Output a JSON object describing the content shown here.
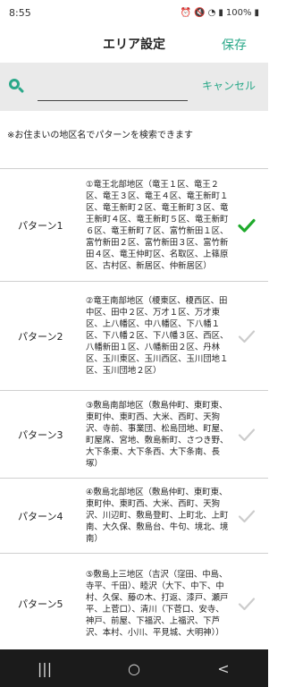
{
  "status_bar": {
    "time": "8:55",
    "battery": "100%"
  },
  "header": {
    "title": "エリア設定",
    "save_label": "保存"
  },
  "search": {
    "value": "",
    "placeholder": "",
    "cancel_label": "キャンセル"
  },
  "hint": "※お住まいの地区名でパターンを検索できます",
  "patterns": [
    {
      "name": "パターン1",
      "description": "①竜王北部地区（竜王１区、竜王２区、竜王３区、竜王４区、竜王新町１区、竜王新町２区、竜王新町３区、竜王新町４区、竜王新町５区、竜王新町６区、竜王新町７区、富竹新田１区、富竹新田２区、富竹新田３区、富竹新田４区、竜王仲町区、名取区、上篠原区、古村区、新居区、仲新居区）",
      "selected": true
    },
    {
      "name": "パターン2",
      "description": "②竜王南部地区（榎東区、榎西区、田中区、田中２区、万才１区、万才東区、上八幡区、中八幡区、下八幡１区、下八幡２区、下八幡３区、西区、八幡新田１区、八幡新田２区、丹林区、玉川東区、玉川西区、玉川団地１区、玉川団地２区）",
      "selected": false
    },
    {
      "name": "パターン3",
      "description": "③敷島南部地区（敷島仲町、東町東、東町仲、東町西、大米、西町、天狗沢、寺前、事業団、松島団地、町屋、町屋席、宮地、敷島新町、さつき野、大下条東、大下条西、大下条南、長塚）",
      "selected": false
    },
    {
      "name": "パターン4",
      "description": "④敷島北部地区（敷島仲町、東町東、東町仲、東町西、大米、西町、天狗沢、川辺町、敷島登町、上町北、上町南、大久保、敷島台、牛句、境北、境南）",
      "selected": false
    },
    {
      "name": "パターン5",
      "description": "⑤敷島上三地区（吉沢（窪田、中島、寺平、千田）、睦沢（大下、中下、中村、久保、藤の木、打返、漆戸、瀬戸平、上菅口）、清川（下菅口、安寺、神戸、前屋、下福沢、上福沢、下芦沢、本村、小川、平見城、大明神））",
      "selected": false
    }
  ],
  "nav": {
    "recent": "|||",
    "home": "○",
    "back": "<"
  },
  "colors": {
    "accent": "#2aa889",
    "check_selected": "#1faa2c",
    "check_unselected": "#cccccc",
    "search_bg": "#eaeaea",
    "nav_bg": "#1b1b1b"
  },
  "icons": {
    "search": "search-icon",
    "check": "check-icon"
  }
}
